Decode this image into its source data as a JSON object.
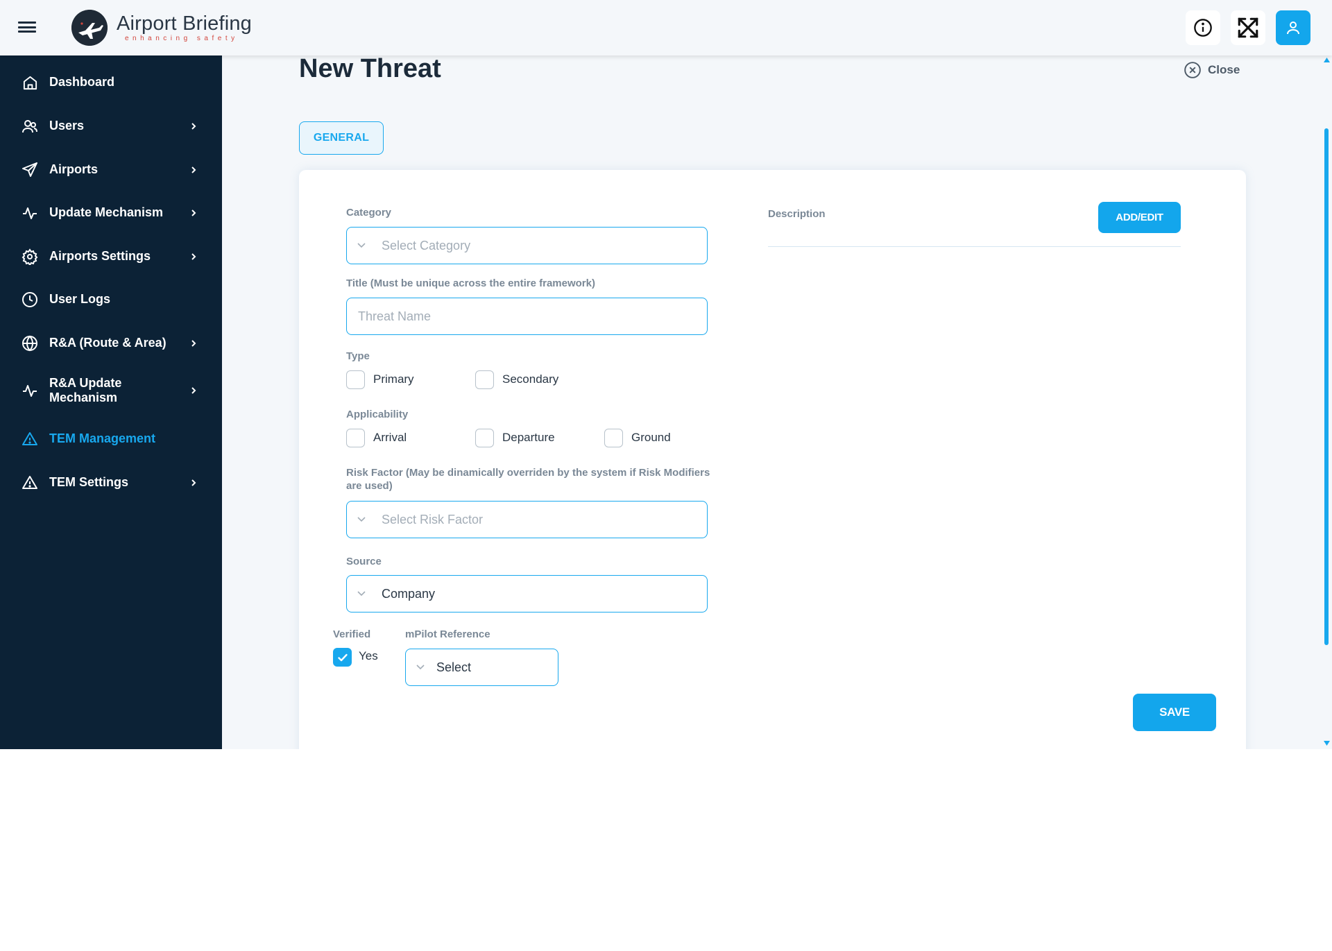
{
  "header": {
    "brand_title": "Airport Briefing",
    "brand_subtitle": "enhancing safety"
  },
  "sidebar": {
    "items": [
      {
        "label": "Dashboard",
        "icon": "home-icon",
        "has_chevron": false,
        "active": false
      },
      {
        "label": "Users",
        "icon": "users-icon",
        "has_chevron": true,
        "active": false
      },
      {
        "label": "Airports",
        "icon": "send-icon",
        "has_chevron": true,
        "active": false
      },
      {
        "label": "Update Mechanism",
        "icon": "activity-icon",
        "has_chevron": true,
        "active": false
      },
      {
        "label": "Airports Settings",
        "icon": "gear-icon",
        "has_chevron": true,
        "active": false
      },
      {
        "label": "User Logs",
        "icon": "clock-icon",
        "has_chevron": false,
        "active": false
      },
      {
        "label": "R&A (Route & Area)",
        "icon": "globe-icon",
        "has_chevron": true,
        "active": false
      },
      {
        "label": "R&A Update Mechanism",
        "icon": "activity-icon",
        "has_chevron": true,
        "active": false
      },
      {
        "label": "TEM Management",
        "icon": "warning-icon",
        "has_chevron": false,
        "active": true
      },
      {
        "label": "TEM Settings",
        "icon": "warning-icon",
        "has_chevron": true,
        "active": false
      }
    ]
  },
  "page": {
    "title": "New Threat",
    "close_label": "Close",
    "tab_general": "GENERAL"
  },
  "form": {
    "category_label": "Category",
    "category_placeholder": "Select Category",
    "title_label": "Title (Must be unique across the entire framework)",
    "title_placeholder": "Threat Name",
    "type_label": "Type",
    "type_options": [
      {
        "label": "Primary",
        "checked": false
      },
      {
        "label": "Secondary",
        "checked": false
      }
    ],
    "applicability_label": "Applicability",
    "applicability_options": [
      {
        "label": "Arrival",
        "checked": false
      },
      {
        "label": "Departure",
        "checked": false
      },
      {
        "label": "Ground",
        "checked": false
      }
    ],
    "risk_factor_label": "Risk Factor (May be dinamically overriden by the system if Risk Modifiers are used)",
    "risk_factor_placeholder": "Select Risk Factor",
    "source_label": "Source",
    "source_value": "Company",
    "verified_label": "Verified",
    "verified_option": {
      "label": "Yes",
      "checked": true
    },
    "mpilot_label": "mPilot Reference",
    "mpilot_value": "Select",
    "description_label": "Description",
    "add_edit_label": "ADD/EDIT",
    "save_label": "SAVE"
  },
  "colors": {
    "accent": "#13a6ec",
    "sidebar_bg": "#0c2236",
    "page_bg": "#f4f7fa",
    "brand_red": "#d2463d"
  }
}
